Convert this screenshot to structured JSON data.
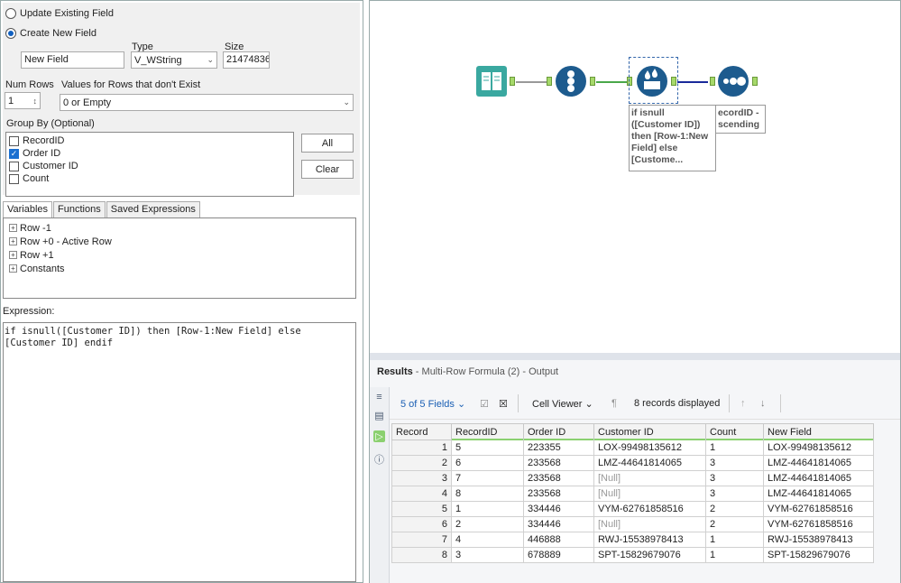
{
  "config": {
    "radio_update": "Update Existing Field",
    "radio_create": "Create New  Field",
    "type_label": "Type",
    "size_label": "Size",
    "field_name": "New Field",
    "type_value": "V_WString",
    "size_value": "21474836",
    "num_rows_label": "Num Rows",
    "num_rows_value": "1",
    "values_label": "Values for Rows that don't Exist",
    "values_value": "0 or Empty",
    "group_by_label": "Group By (Optional)",
    "group_fields": [
      {
        "label": "RecordID",
        "checked": false
      },
      {
        "label": "Order ID",
        "checked": true
      },
      {
        "label": "Customer ID",
        "checked": false
      },
      {
        "label": "Count",
        "checked": false
      }
    ],
    "all_button": "All",
    "clear_button": "Clear"
  },
  "tabs": [
    "Variables",
    "Functions",
    "Saved Expressions"
  ],
  "variables": [
    "Row -1",
    "Row +0 - Active Row",
    "Row +1",
    "Constants"
  ],
  "expression_label": "Expression:",
  "expression": "if isnull([Customer ID]) then [Row-1:New Field] else\n[Customer ID] endif",
  "canvas": {
    "annotation_formula": "if isnull\n([Customer ID])\nthen [Row-1:New\nField] else\n[Custome...",
    "annotation_sort": "ecordID -\nscending"
  },
  "results": {
    "title": "Results",
    "subtitle": " - Multi-Row Formula (2) - Output",
    "fields_selector": "5 of 5 Fields",
    "cell_viewer": "Cell Viewer",
    "records_displayed": "8 records displayed",
    "columns": [
      "Record",
      "RecordID",
      "Order ID",
      "Customer ID",
      "Count",
      "New Field"
    ],
    "rows": [
      [
        "1",
        "5",
        "223355",
        "LOX-99498135612",
        "1",
        "LOX-99498135612"
      ],
      [
        "2",
        "6",
        "233568",
        "LMZ-44641814065",
        "3",
        "LMZ-44641814065"
      ],
      [
        "3",
        "7",
        "233568",
        "[Null]",
        "3",
        "LMZ-44641814065"
      ],
      [
        "4",
        "8",
        "233568",
        "[Null]",
        "3",
        "LMZ-44641814065"
      ],
      [
        "5",
        "1",
        "334446",
        "VYM-62761858516",
        "2",
        "VYM-62761858516"
      ],
      [
        "6",
        "2",
        "334446",
        "[Null]",
        "2",
        "VYM-62761858516"
      ],
      [
        "7",
        "4",
        "446888",
        "RWJ-15538978413",
        "1",
        "RWJ-15538978413"
      ],
      [
        "8",
        "3",
        "678889",
        "SPT-15829679076",
        "1",
        "SPT-15829679076"
      ]
    ]
  }
}
